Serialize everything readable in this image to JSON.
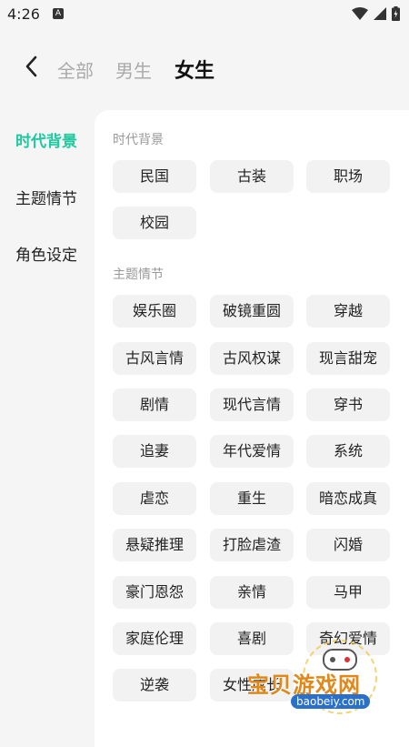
{
  "status_bar": {
    "time": "4:26",
    "notification_letter": "A"
  },
  "header": {
    "tabs": [
      {
        "label": "全部",
        "active": false
      },
      {
        "label": "男生",
        "active": false
      },
      {
        "label": "女生",
        "active": true
      }
    ]
  },
  "sidebar": {
    "items": [
      {
        "label": "时代背景",
        "active": true
      },
      {
        "label": "主题情节",
        "active": false
      },
      {
        "label": "角色设定",
        "active": false
      }
    ],
    "accent_color": "#1fc9a0"
  },
  "sections": [
    {
      "title": "时代背景",
      "tags": [
        "民国",
        "古装",
        "职场",
        "校园"
      ]
    },
    {
      "title": "主题情节",
      "tags": [
        "娱乐圈",
        "破镜重圆",
        "穿越",
        "古风言情",
        "古风权谋",
        "现言甜宠",
        "剧情",
        "现代言情",
        "穿书",
        "追妻",
        "年代爱情",
        "系统",
        "虐恋",
        "重生",
        "暗恋成真",
        "悬疑推理",
        "打脸虐渣",
        "闪婚",
        "豪门恩怨",
        "亲情",
        "马甲",
        "家庭伦理",
        "喜剧",
        "奇幻爱情",
        "逆袭",
        "女性成长"
      ]
    }
  ],
  "watermark": {
    "text": "宝贝游戏网",
    "url": "baobeiy.com"
  }
}
